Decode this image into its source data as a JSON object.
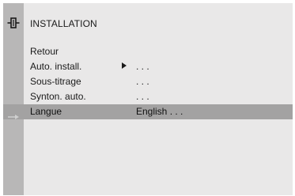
{
  "menu": {
    "title": "INSTALLATION",
    "title_icon": "antenna-plug-icon",
    "items": [
      {
        "label": "Retour",
        "value": ""
      },
      {
        "label": "Auto. install.",
        "value": ". . .",
        "has_arrow": true
      },
      {
        "label": "Sous-titrage",
        "value": ". . ."
      },
      {
        "label": "Synton. auto.",
        "value": ". . ."
      },
      {
        "label": "Langue",
        "value": "English . . .",
        "selected": true
      }
    ],
    "selection_icon": "right-arrow-icon"
  },
  "colors": {
    "background": "#e9e8e8",
    "left_strip": "#b8b7b7",
    "selected_row": "#a3a2a2",
    "text": "#1a1a1a"
  }
}
